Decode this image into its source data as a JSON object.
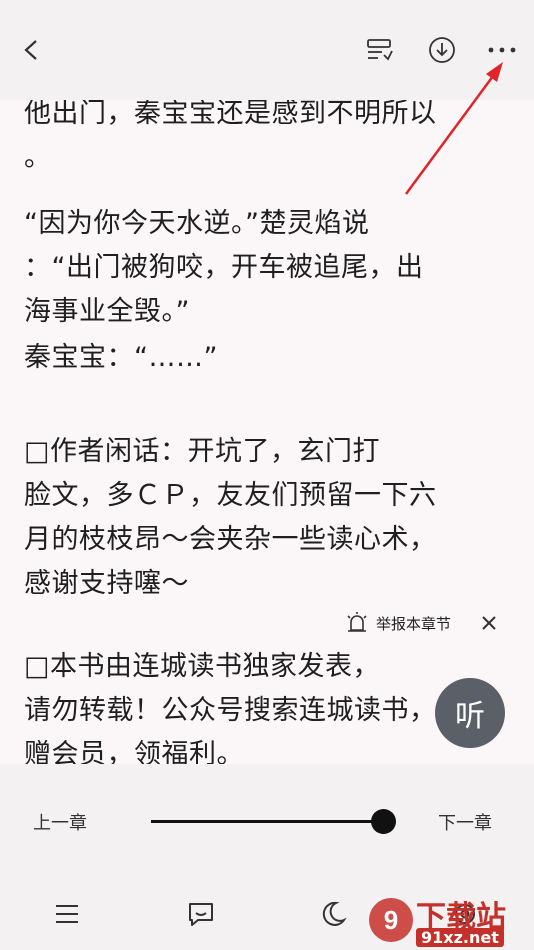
{
  "paragraphs": [
    {
      "text": "他出门，秦宝宝还是感到不明所以\n。"
    },
    {
      "text": "        “因为你今天水逆。”楚灵焰说\n：“出门被狗咬，开车被追尾，出\n海事业全毁。”"
    },
    {
      "text": "        秦宝宝：“……”"
    },
    {
      "text": "        □作者闲话：开坑了，玄门打\n脸文，多ＣＰ，友友们预留一下六\n月的枝枝昂～会夹杂一些读心术，\n感谢支持噻～"
    },
    {
      "text": "        □本书由连城读书独家发表，\n请勿转载！公众号搜索连城读书，\n赠会员，领福利。"
    }
  ],
  "report": {
    "label": "举报本章节"
  },
  "listen": {
    "label": "听"
  },
  "nav": {
    "prev": "上一章",
    "next": "下一章",
    "progress": 1.0
  },
  "watermark": {
    "title": "下载站",
    "url": "91xz.net"
  },
  "colors": {
    "accent": "#c6302a",
    "listen_bg": "#5b6068"
  }
}
